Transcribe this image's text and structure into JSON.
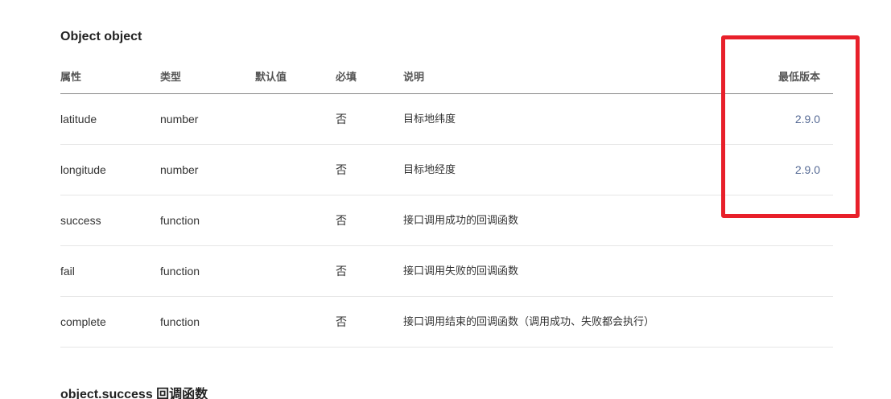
{
  "section1": {
    "title": "Object object"
  },
  "table": {
    "headers": {
      "name": "属性",
      "type": "类型",
      "default": "默认值",
      "required": "必填",
      "desc": "说明",
      "version": "最低版本"
    },
    "rows": [
      {
        "name": "latitude",
        "type": "number",
        "default": "",
        "required": "否",
        "desc": "目标地纬度",
        "version": "2.9.0"
      },
      {
        "name": "longitude",
        "type": "number",
        "default": "",
        "required": "否",
        "desc": "目标地经度",
        "version": "2.9.0"
      },
      {
        "name": "success",
        "type": "function",
        "default": "",
        "required": "否",
        "desc": "接口调用成功的回调函数",
        "version": ""
      },
      {
        "name": "fail",
        "type": "function",
        "default": "",
        "required": "否",
        "desc": "接口调用失败的回调函数",
        "version": ""
      },
      {
        "name": "complete",
        "type": "function",
        "default": "",
        "required": "否",
        "desc": "接口调用结束的回调函数（调用成功、失败都会执行）",
        "version": ""
      }
    ]
  },
  "section2": {
    "title": "object.success 回调函数"
  },
  "annotation": {
    "box_color": "#e8202a"
  }
}
